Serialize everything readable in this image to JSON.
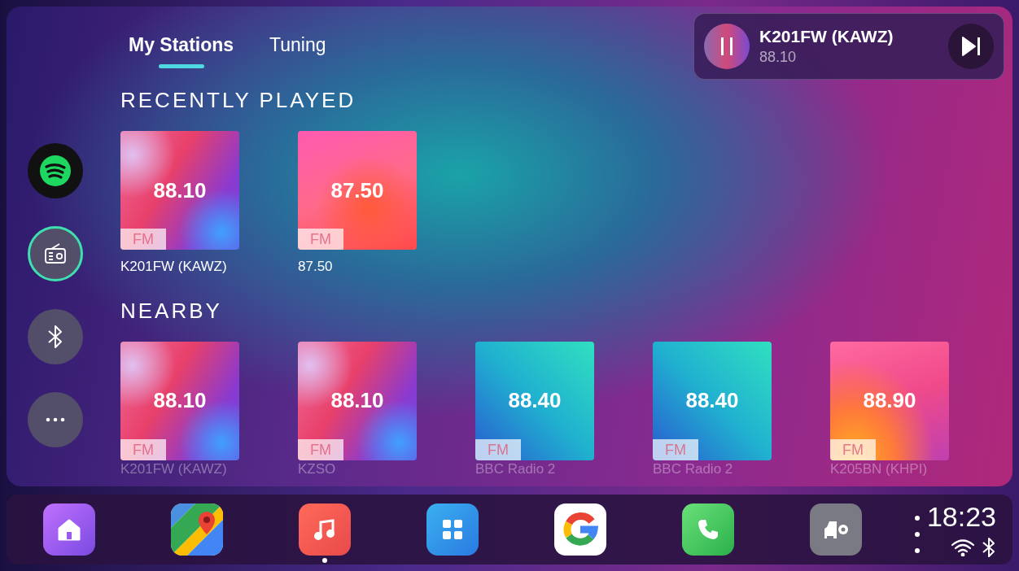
{
  "tabs": [
    {
      "label": "My Stations",
      "selected": true
    },
    {
      "label": "Tuning",
      "selected": false
    }
  ],
  "now_playing": {
    "title": "K201FW (KAWZ)",
    "frequency": "88.10",
    "playing": true
  },
  "sources": [
    {
      "kind": "spotify",
      "selected": false
    },
    {
      "kind": "radio",
      "selected": true
    },
    {
      "kind": "bluetooth",
      "selected": false
    },
    {
      "kind": "more",
      "selected": false
    }
  ],
  "recently_played": {
    "heading": "RECENTLY PLAYED",
    "stations": [
      {
        "frequency": "88.10",
        "band": "FM",
        "name": "K201FW (KAWZ)",
        "kind": "wave"
      },
      {
        "frequency": "87.50",
        "band": "FM",
        "name": "87.50",
        "kind": "coral"
      }
    ]
  },
  "nearby": {
    "heading": "NEARBY",
    "stations": [
      {
        "frequency": "88.10",
        "band": "FM",
        "name": "K201FW (KAWZ)",
        "kind": "wave"
      },
      {
        "frequency": "88.10",
        "band": "FM",
        "name": "KZSO",
        "kind": "wave"
      },
      {
        "frequency": "88.40",
        "band": "FM",
        "name": "BBC Radio 2",
        "kind": "aqua"
      },
      {
        "frequency": "88.40",
        "band": "FM",
        "name": "BBC Radio 2",
        "kind": "aqua"
      },
      {
        "frequency": "88.90",
        "band": "FM",
        "name": "K205BN (KHPI)",
        "kind": "sunset"
      }
    ]
  },
  "dock": [
    {
      "kind": "home",
      "selected": false
    },
    {
      "kind": "maps",
      "selected": false
    },
    {
      "kind": "music",
      "selected": true
    },
    {
      "kind": "apps",
      "selected": false
    },
    {
      "kind": "google",
      "selected": false
    },
    {
      "kind": "phone",
      "selected": false
    },
    {
      "kind": "car",
      "selected": false
    }
  ],
  "status": {
    "time": "18:23"
  }
}
